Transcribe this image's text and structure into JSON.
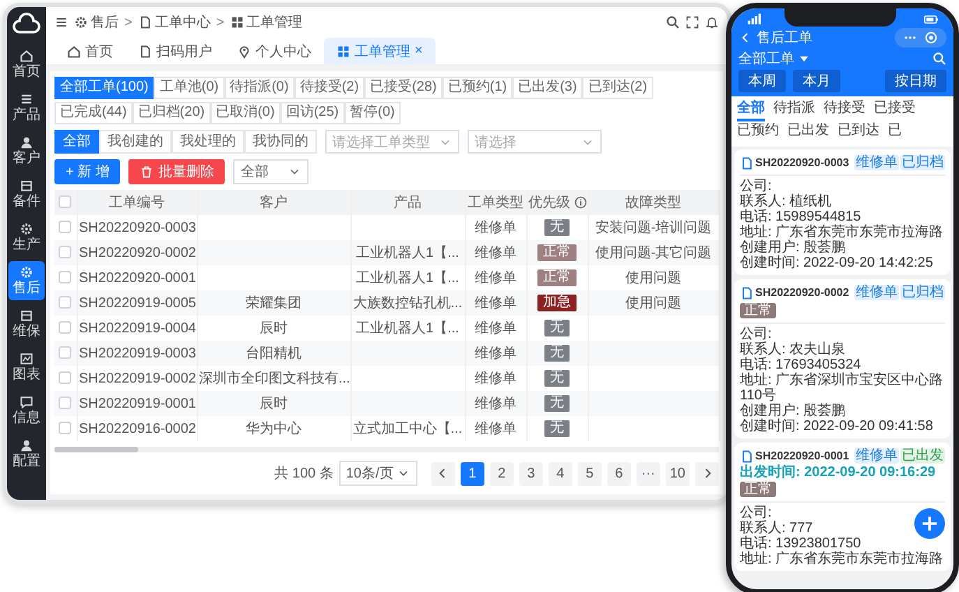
{
  "sidebar": {
    "items": [
      {
        "label": "首页",
        "selected": false
      },
      {
        "label": "产品",
        "selected": false
      },
      {
        "label": "客户",
        "selected": false
      },
      {
        "label": "备件",
        "selected": false
      },
      {
        "label": "生产",
        "selected": false
      },
      {
        "label": "售后",
        "selected": true
      },
      {
        "label": "维保",
        "selected": false
      },
      {
        "label": "图表",
        "selected": false
      },
      {
        "label": "信息",
        "selected": false
      },
      {
        "label": "配置",
        "selected": false
      }
    ]
  },
  "breadcrumb": [
    {
      "label": "售后"
    },
    {
      "separator": ">",
      "label": "工单中心"
    },
    {
      "separator": ">",
      "label": "工单管理"
    }
  ],
  "page_tabs": [
    {
      "label": "首页",
      "selected": false
    },
    {
      "label": "扫码用户",
      "selected": false
    },
    {
      "label": "个人中心",
      "selected": false
    },
    {
      "label": "工单管理",
      "selected": true,
      "close": "×"
    }
  ],
  "status_tabs": [
    {
      "label": "全部工单(100)",
      "selected": true
    },
    {
      "label": "工单池(0)",
      "selected": false
    },
    {
      "label": "待指派(0)",
      "selected": false
    },
    {
      "label": "待接受(2)",
      "selected": false
    },
    {
      "label": "已接受(28)",
      "selected": false
    },
    {
      "label": "已预约(1)",
      "selected": false
    },
    {
      "label": "已出发(3)",
      "selected": false
    },
    {
      "label": "已到达(2)",
      "selected": false
    },
    {
      "label": "已完成(44)",
      "selected": false
    },
    {
      "label": "已归档(20)",
      "selected": false
    },
    {
      "label": "已取消(0)",
      "selected": false
    },
    {
      "label": "回访(25)",
      "selected": false
    },
    {
      "label": "暂停(0)",
      "selected": false
    }
  ],
  "filter_tabs": [
    {
      "label": "全部",
      "selected": true
    },
    {
      "label": "我创建的",
      "selected": false
    },
    {
      "label": "我处理的",
      "selected": false
    },
    {
      "label": "我协同的",
      "selected": false
    }
  ],
  "selects": [
    {
      "placeholder": "请选择工单类型"
    },
    {
      "placeholder": "请选择"
    }
  ],
  "actions": {
    "add": "+ 新 增",
    "delete": "批量删除",
    "scope": "全部"
  },
  "table": {
    "select_all_checked": false,
    "columns": [
      "工单编号",
      "客户",
      "产品",
      "工单类型",
      "优先级",
      "故障类型"
    ],
    "rows": [
      {
        "checked": false,
        "number": "SH20220920-0003",
        "type": "维修单",
        "priority": {
          "text": "无",
          "color": "#7b7f86"
        },
        "fault": "安装问题-培训问题"
      },
      {
        "checked": false,
        "number": "SH20220920-0002",
        "product": "工业机器人1【...",
        "type": "维修单",
        "priority": {
          "text": "正常",
          "color": "#9e8080"
        },
        "fault": "使用问题-其它问题"
      },
      {
        "checked": false,
        "number": "SH20220920-0001",
        "product": "工业机器人1【...",
        "type": "维修单",
        "priority": {
          "text": "正常",
          "color": "#9e8080"
        },
        "fault": "使用问题"
      },
      {
        "checked": false,
        "number": "SH20220919-0005",
        "customer": "荣耀集团",
        "product": "大族数控钻孔机...",
        "type": "维修单",
        "priority": {
          "text": "加急",
          "color": "#8b2323"
        },
        "fault": "使用问题"
      },
      {
        "checked": false,
        "number": "SH20220919-0004",
        "customer": "辰时",
        "product": "工业机器人1【...",
        "type": "维修单",
        "priority": {
          "text": "无",
          "color": "#7b7f86"
        }
      },
      {
        "checked": false,
        "number": "SH20220919-0003",
        "customer": "台阳精机",
        "type": "维修单",
        "priority": {
          "text": "无",
          "color": "#7b7f86"
        }
      },
      {
        "checked": false,
        "number": "SH20220919-0002",
        "customer": "深圳市全印图文科技有...",
        "type": "维修单",
        "priority": {
          "text": "无",
          "color": "#7b7f86"
        }
      },
      {
        "checked": false,
        "number": "SH20220919-0001",
        "customer": "辰时",
        "type": "维修单",
        "priority": {
          "text": "无",
          "color": "#7b7f86"
        }
      },
      {
        "checked": false,
        "number": "SH20220916-0002",
        "customer": "华为中心",
        "product": "立式加工中心【...",
        "type": "维修单",
        "priority": {
          "text": "无",
          "color": "#7b7f86"
        }
      }
    ]
  },
  "pagination": {
    "total": "共 100 条",
    "page_size": "10条/页",
    "pages": [
      {
        "label": "1",
        "selected": true
      },
      {
        "label": "2",
        "selected": false
      },
      {
        "label": "3",
        "selected": false
      },
      {
        "label": "4",
        "selected": false
      },
      {
        "label": "5",
        "selected": false
      },
      {
        "label": "6",
        "selected": false
      },
      {
        "label": "···",
        "selected": false
      },
      {
        "label": "10",
        "selected": false
      }
    ]
  },
  "phone": {
    "title": "售后工单",
    "filter": "全部工单",
    "buttons": [
      "本周",
      "本月"
    ],
    "date_button": "按日期",
    "tabs": [
      {
        "label": "全部",
        "selected": true
      },
      {
        "label": "待指派",
        "selected": false
      },
      {
        "label": "待接受",
        "selected": false
      },
      {
        "label": "已接受",
        "selected": false
      },
      {
        "label": "已预约",
        "selected": false
      },
      {
        "label": "已出发",
        "selected": false
      },
      {
        "label": "已到达",
        "selected": false
      },
      {
        "label": "已",
        "selected": false
      }
    ],
    "cards": [
      {
        "number": "SH20220920-0003",
        "tags": [
          {
            "text": "维修单",
            "color": "#1e7fe0"
          },
          {
            "text": "已归档",
            "color": "#1e7fe0"
          }
        ],
        "fields": [
          {
            "label": "公司:"
          },
          {
            "label": "联系人:",
            "value": "植纸机"
          },
          {
            "label": "电话:",
            "value": "15989544815"
          },
          {
            "label": "地址:",
            "value": "广东省东莞市东莞市拉海路"
          },
          {
            "label": "创建用户:",
            "value": "殷荟鹏"
          },
          {
            "label": "创建时间:",
            "value": "2022-09-20 14:42:25"
          }
        ]
      },
      {
        "number": "SH20220920-0002",
        "tags": [
          {
            "text": "维修单",
            "color": "#1e7fe0"
          },
          {
            "text": "已归档",
            "color": "#1e7fe0"
          }
        ],
        "priority": "正常",
        "fields": [
          {
            "label": "公司:"
          },
          {
            "label": "联系人:",
            "value": "农夫山泉"
          },
          {
            "label": "电话:",
            "value": "17693405324"
          },
          {
            "label": "地址:",
            "value": "广东省深圳市宝安区中心路110号"
          },
          {
            "label": "创建用户:",
            "value": "殷荟鹏"
          },
          {
            "label": "创建时间:",
            "value": "2022-09-20 09:41:58"
          }
        ]
      },
      {
        "number": "SH20220920-0001",
        "tags": [
          {
            "text": "维修单",
            "color": "#1e7fe0"
          },
          {
            "text": "已出发",
            "color": "#2e9e4a"
          }
        ],
        "departure": "出发时间: 2022-09-20 09:16:29",
        "priority": "正常",
        "fields": [
          {
            "label": "公司:"
          },
          {
            "label": "联系人:",
            "value": "777"
          },
          {
            "label": "电话:",
            "value": "13923801750"
          },
          {
            "label": "地址:",
            "value": "广东省东莞市东莞市拉海路"
          }
        ]
      }
    ],
    "fab": "+"
  }
}
